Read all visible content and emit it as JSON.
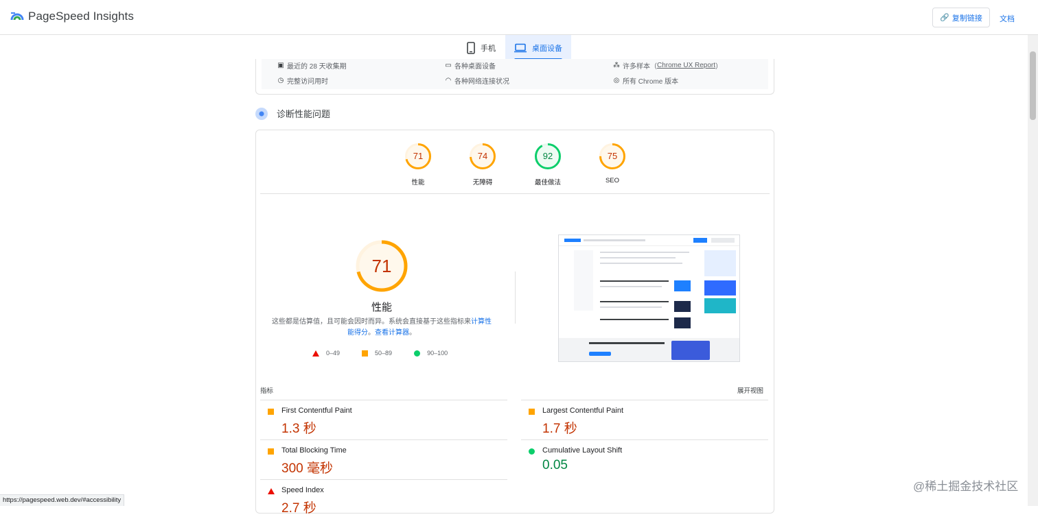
{
  "app": {
    "title": "PageSpeed Insights"
  },
  "header": {
    "copy_link": "复制链接",
    "docs": "文档"
  },
  "tabs": [
    {
      "label": "手机",
      "active": false
    },
    {
      "label": "桌面设备",
      "active": true
    }
  ],
  "field_info": {
    "period": "最近的 28 天收集期",
    "devices": "各种桌面设备",
    "samples_prefix": "许多样本（",
    "samples_link": "Chrome UX Report",
    "samples_suffix": "）",
    "duration": "完整访问用时",
    "network": "各种网络连接状况",
    "chrome": "所有 Chrome 版本"
  },
  "diagnose": {
    "title": "诊断性能问题"
  },
  "categories": [
    {
      "label": "性能",
      "score": "71",
      "status": "average"
    },
    {
      "label": "无障碍",
      "score": "74",
      "status": "average"
    },
    {
      "label": "最佳做法",
      "score": "92",
      "status": "pass"
    },
    {
      "label": "SEO",
      "score": "75",
      "status": "average"
    }
  ],
  "performance": {
    "score": "71",
    "score_fraction": 0.71,
    "label": "性能",
    "note_text": "这些都是估算值，且可能会因时而异。系统会直接基于这些指标来",
    "note_link1": "计算性能得分",
    "note_sep": "。",
    "note_link2": "查看计算器",
    "note_end": "。",
    "legend": [
      {
        "range": "0–49"
      },
      {
        "range": "50–89"
      },
      {
        "range": "90–100"
      }
    ]
  },
  "metrics": {
    "header_left": "指标",
    "header_right": "展开视图",
    "items": [
      {
        "name": "First Contentful Paint",
        "value": "1.3 秒",
        "status": "average"
      },
      {
        "name": "Largest Contentful Paint",
        "value": "1.7 秒",
        "status": "average"
      },
      {
        "name": "Total Blocking Time",
        "value": "300 毫秒",
        "status": "average"
      },
      {
        "name": "Cumulative Layout Shift",
        "value": "0.05",
        "status": "pass"
      },
      {
        "name": "Speed Index",
        "value": "2.7 秒",
        "status": "fail"
      }
    ]
  },
  "status_bar": {
    "url": "https://pagespeed.web.dev/#accessibility"
  },
  "watermark": "@稀土掘金技术社区",
  "colors": {
    "orange": "#ffa400",
    "green": "#0cce6b",
    "red": "#eb0f00",
    "blue": "#1a73e8"
  }
}
